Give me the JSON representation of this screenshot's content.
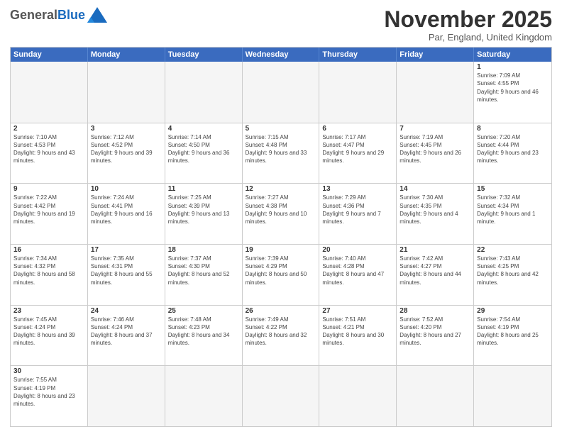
{
  "logo": {
    "general": "General",
    "blue": "Blue"
  },
  "title": "November 2025",
  "subtitle": "Par, England, United Kingdom",
  "header_days": [
    "Sunday",
    "Monday",
    "Tuesday",
    "Wednesday",
    "Thursday",
    "Friday",
    "Saturday"
  ],
  "weeks": [
    [
      {
        "day": "",
        "info": ""
      },
      {
        "day": "",
        "info": ""
      },
      {
        "day": "",
        "info": ""
      },
      {
        "day": "",
        "info": ""
      },
      {
        "day": "",
        "info": ""
      },
      {
        "day": "",
        "info": ""
      },
      {
        "day": "1",
        "info": "Sunrise: 7:09 AM\nSunset: 4:55 PM\nDaylight: 9 hours and 46 minutes."
      }
    ],
    [
      {
        "day": "2",
        "info": "Sunrise: 7:10 AM\nSunset: 4:53 PM\nDaylight: 9 hours and 43 minutes."
      },
      {
        "day": "3",
        "info": "Sunrise: 7:12 AM\nSunset: 4:52 PM\nDaylight: 9 hours and 39 minutes."
      },
      {
        "day": "4",
        "info": "Sunrise: 7:14 AM\nSunset: 4:50 PM\nDaylight: 9 hours and 36 minutes."
      },
      {
        "day": "5",
        "info": "Sunrise: 7:15 AM\nSunset: 4:48 PM\nDaylight: 9 hours and 33 minutes."
      },
      {
        "day": "6",
        "info": "Sunrise: 7:17 AM\nSunset: 4:47 PM\nDaylight: 9 hours and 29 minutes."
      },
      {
        "day": "7",
        "info": "Sunrise: 7:19 AM\nSunset: 4:45 PM\nDaylight: 9 hours and 26 minutes."
      },
      {
        "day": "8",
        "info": "Sunrise: 7:20 AM\nSunset: 4:44 PM\nDaylight: 9 hours and 23 minutes."
      }
    ],
    [
      {
        "day": "9",
        "info": "Sunrise: 7:22 AM\nSunset: 4:42 PM\nDaylight: 9 hours and 19 minutes."
      },
      {
        "day": "10",
        "info": "Sunrise: 7:24 AM\nSunset: 4:41 PM\nDaylight: 9 hours and 16 minutes."
      },
      {
        "day": "11",
        "info": "Sunrise: 7:25 AM\nSunset: 4:39 PM\nDaylight: 9 hours and 13 minutes."
      },
      {
        "day": "12",
        "info": "Sunrise: 7:27 AM\nSunset: 4:38 PM\nDaylight: 9 hours and 10 minutes."
      },
      {
        "day": "13",
        "info": "Sunrise: 7:29 AM\nSunset: 4:36 PM\nDaylight: 9 hours and 7 minutes."
      },
      {
        "day": "14",
        "info": "Sunrise: 7:30 AM\nSunset: 4:35 PM\nDaylight: 9 hours and 4 minutes."
      },
      {
        "day": "15",
        "info": "Sunrise: 7:32 AM\nSunset: 4:34 PM\nDaylight: 9 hours and 1 minute."
      }
    ],
    [
      {
        "day": "16",
        "info": "Sunrise: 7:34 AM\nSunset: 4:32 PM\nDaylight: 8 hours and 58 minutes."
      },
      {
        "day": "17",
        "info": "Sunrise: 7:35 AM\nSunset: 4:31 PM\nDaylight: 8 hours and 55 minutes."
      },
      {
        "day": "18",
        "info": "Sunrise: 7:37 AM\nSunset: 4:30 PM\nDaylight: 8 hours and 52 minutes."
      },
      {
        "day": "19",
        "info": "Sunrise: 7:39 AM\nSunset: 4:29 PM\nDaylight: 8 hours and 50 minutes."
      },
      {
        "day": "20",
        "info": "Sunrise: 7:40 AM\nSunset: 4:28 PM\nDaylight: 8 hours and 47 minutes."
      },
      {
        "day": "21",
        "info": "Sunrise: 7:42 AM\nSunset: 4:27 PM\nDaylight: 8 hours and 44 minutes."
      },
      {
        "day": "22",
        "info": "Sunrise: 7:43 AM\nSunset: 4:25 PM\nDaylight: 8 hours and 42 minutes."
      }
    ],
    [
      {
        "day": "23",
        "info": "Sunrise: 7:45 AM\nSunset: 4:24 PM\nDaylight: 8 hours and 39 minutes."
      },
      {
        "day": "24",
        "info": "Sunrise: 7:46 AM\nSunset: 4:24 PM\nDaylight: 8 hours and 37 minutes."
      },
      {
        "day": "25",
        "info": "Sunrise: 7:48 AM\nSunset: 4:23 PM\nDaylight: 8 hours and 34 minutes."
      },
      {
        "day": "26",
        "info": "Sunrise: 7:49 AM\nSunset: 4:22 PM\nDaylight: 8 hours and 32 minutes."
      },
      {
        "day": "27",
        "info": "Sunrise: 7:51 AM\nSunset: 4:21 PM\nDaylight: 8 hours and 30 minutes."
      },
      {
        "day": "28",
        "info": "Sunrise: 7:52 AM\nSunset: 4:20 PM\nDaylight: 8 hours and 27 minutes."
      },
      {
        "day": "29",
        "info": "Sunrise: 7:54 AM\nSunset: 4:19 PM\nDaylight: 8 hours and 25 minutes."
      }
    ],
    [
      {
        "day": "30",
        "info": "Sunrise: 7:55 AM\nSunset: 4:19 PM\nDaylight: 8 hours and 23 minutes."
      },
      {
        "day": "",
        "info": ""
      },
      {
        "day": "",
        "info": ""
      },
      {
        "day": "",
        "info": ""
      },
      {
        "day": "",
        "info": ""
      },
      {
        "day": "",
        "info": ""
      },
      {
        "day": "",
        "info": ""
      }
    ]
  ]
}
